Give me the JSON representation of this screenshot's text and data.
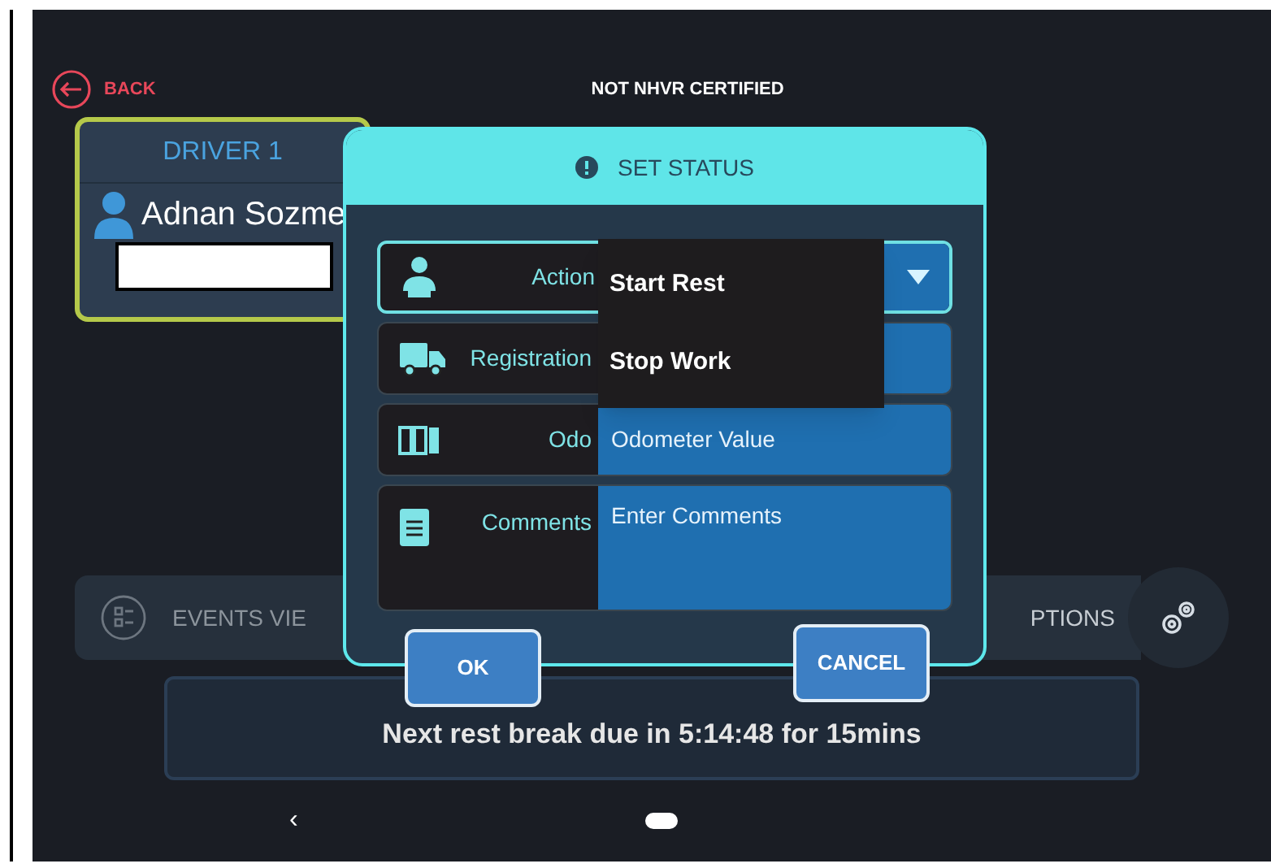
{
  "header": {
    "back": "BACK",
    "title": "NOT NHVR CERTIFIED"
  },
  "driver_card": {
    "label": "DRIVER 1",
    "name": "Adnan Sozme"
  },
  "bottom_menu": [
    {
      "label": "EVENTS VIE"
    },
    {
      "label": "PTIONS"
    }
  ],
  "status_message": "Next rest break due in 5:14:48 for 15mins",
  "nav": {
    "back": "‹"
  },
  "dialog": {
    "title": "SET STATUS",
    "fields": [
      {
        "kind": "select",
        "label": "Action"
      },
      {
        "kind": "input",
        "label": "Registration"
      },
      {
        "kind": "input",
        "label": "Odo",
        "placeholder": "Odometer Value"
      },
      {
        "kind": "textarea",
        "label": "Comments",
        "placeholder": "Enter Comments"
      }
    ],
    "dropdown": [
      "Start Rest",
      "Stop Work"
    ],
    "buttons": [
      "OK",
      "CANCEL"
    ]
  }
}
